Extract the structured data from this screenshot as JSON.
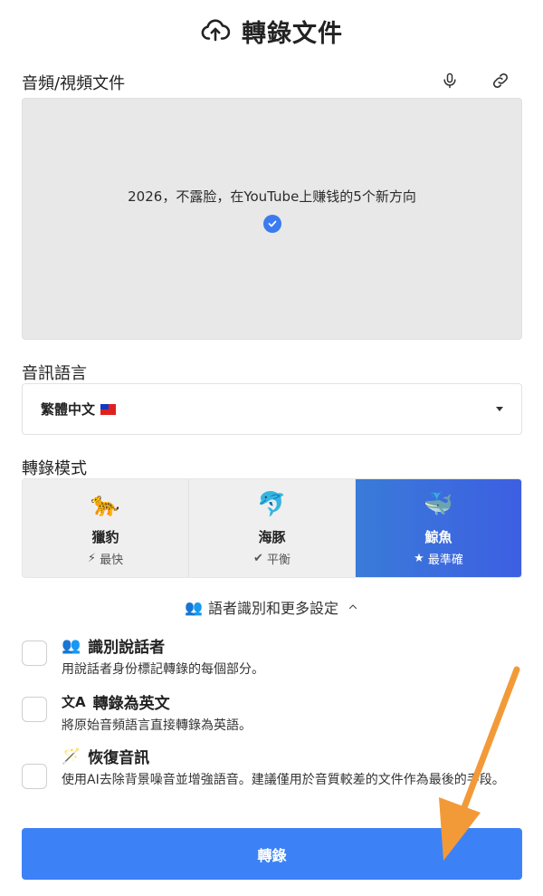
{
  "header": {
    "title": "轉錄文件",
    "icon": "cloud-upload-icon"
  },
  "file": {
    "section_label": "音頻/視頻文件",
    "mic_icon": "microphone-icon",
    "link_icon": "link-icon",
    "filename": "2026，不露脸，在YouTube上赚钱的5个新方向"
  },
  "language": {
    "section_label": "音訊語言",
    "selected": "繁體中文",
    "flag": "taiwan-flag-icon"
  },
  "mode": {
    "section_label": "轉錄模式",
    "options": [
      {
        "emoji": "🐆",
        "name": "獵豹",
        "icon": "⚡",
        "sub": "最快",
        "active": false
      },
      {
        "emoji": "🐬",
        "name": "海豚",
        "icon": "✔",
        "sub": "平衡",
        "active": false
      },
      {
        "emoji": "🐳",
        "name": "鯨魚",
        "icon": "★",
        "sub": "最準確",
        "active": true
      }
    ],
    "active_color": "#3a6fdc"
  },
  "more": {
    "label": "語者識別和更多設定",
    "icon": "👥",
    "chevron": "^"
  },
  "options": [
    {
      "icon": "👥",
      "title": "識別說話者",
      "desc": "用說話者身份標記轉錄的每個部分。",
      "checked": false
    },
    {
      "icon": "文A",
      "title": "轉錄為英文",
      "desc": "將原始音頻語言直接轉錄為英語。",
      "checked": false
    },
    {
      "icon": "🪄",
      "title": "恢復音訊",
      "desc": "使用AI去除背景噪音並增強語音。建議僅用於音質較差的文件作為最後的手段。",
      "checked": false
    }
  ],
  "submit": {
    "label": "轉錄",
    "color": "#3c82f6"
  },
  "annotation": {
    "arrow_color": "#f29a38"
  }
}
